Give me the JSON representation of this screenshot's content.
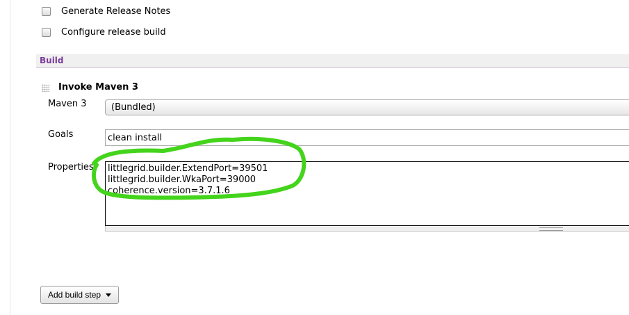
{
  "options": [
    {
      "label": "Generate Release Notes",
      "checked": false
    },
    {
      "label": "Configure release build",
      "checked": false
    }
  ],
  "section": {
    "title": "Build"
  },
  "build_step": {
    "title": "Invoke Maven 3",
    "maven_label": "Maven 3",
    "maven_value": "(Bundled)",
    "goals_label": "Goals",
    "goals_value": "clean install",
    "properties_label": "Properties",
    "properties_lines": [
      "littlegrid.builder.ExtendPort=39501",
      "littlegrid.builder.WkaPort=39000",
      "coherence.version=3.7.1.6"
    ]
  },
  "add_build_step": {
    "label": "Add build step"
  },
  "colors": {
    "section_title": "#7a3d98",
    "annotation": "#44d41c"
  }
}
